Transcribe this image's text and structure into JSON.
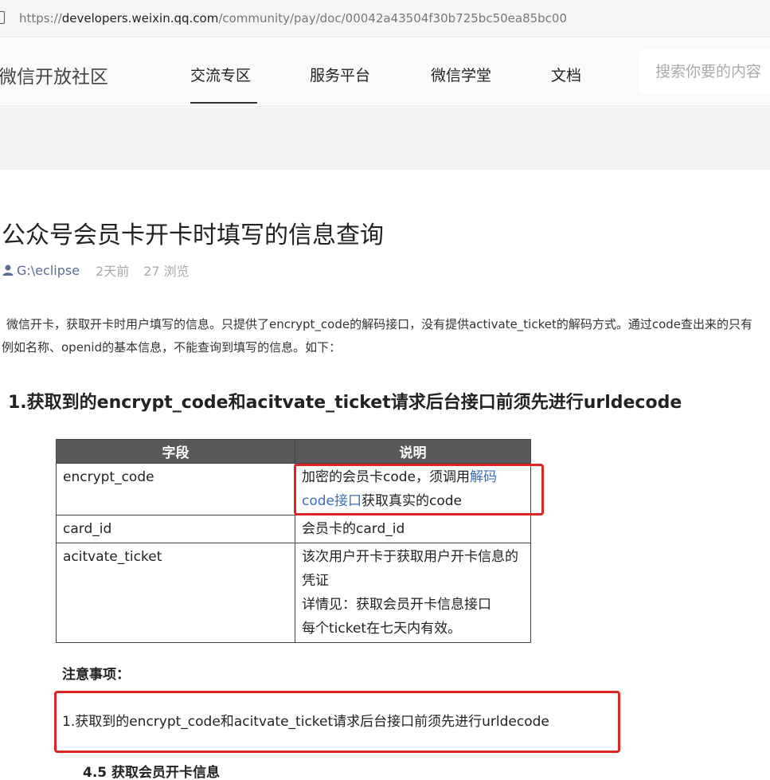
{
  "browser": {
    "url_host_prefix": "https://",
    "url_host": "developers.weixin.qq.com",
    "url_path": "/community/pay/doc/00042a43504f30b725bc50ea85bc00"
  },
  "nav": {
    "brand": "微信开放社区",
    "items": [
      "交流专区",
      "服务平台",
      "微信学堂",
      "文档"
    ],
    "active_index": 0,
    "search_placeholder": "搜索你要的内容"
  },
  "article": {
    "title": "公众号会员卡开卡时填写的信息查询",
    "author": "G:\\eclipse",
    "time": "2天前",
    "views": "27 浏览",
    "paragraph": "微信开卡，获取开卡时用户填写的信息。只提供了encrypt_code的解码接口，没有提供activate_ticket的解码方式。通过code查出来的只有例如名称、openid的基本信息，不能查询到填写的信息。如下：",
    "heading": "1.获取到的encrypt_code和acitvate_ticket请求后台接口前须先进行urldecode"
  },
  "embedded": {
    "table_headers": [
      "字段",
      "说明"
    ],
    "rows": [
      {
        "field": "encrypt_code",
        "desc_pre": "加密的会员卡code，须调用",
        "desc_link": "解码code接口",
        "desc_post": "获取真实的code"
      },
      {
        "field": "card_id",
        "desc": "会员卡的card_id"
      },
      {
        "field": "acitvate_ticket",
        "desc_lines": [
          "该次用户开卡于获取用户开卡信息的凭证",
          "详情见：获取会员开卡信息接口",
          "每个ticket在七天内有效。"
        ]
      }
    ],
    "note_title": "注意事项：",
    "note_text": "1.获取到的encrypt_code和acitvate_ticket请求后台接口前须先进行urldecode",
    "section_title": "4.5   获取会员开卡信息"
  },
  "colors": {
    "accent_link": "#576b95",
    "highlight_red": "#e02424"
  }
}
